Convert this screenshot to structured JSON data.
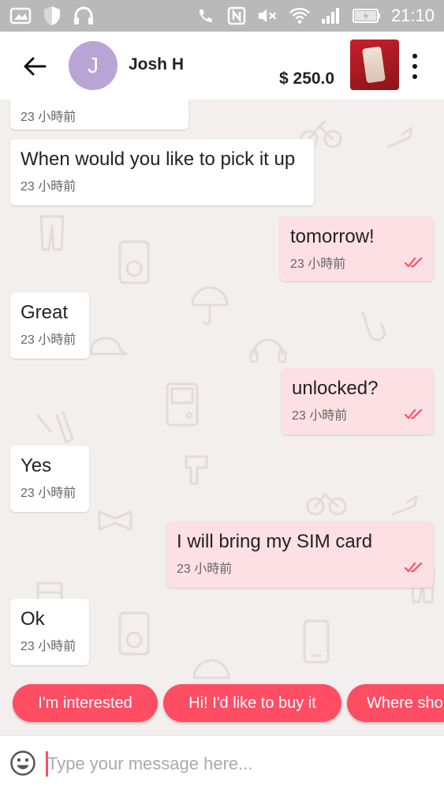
{
  "status_bar": {
    "time": "21:10"
  },
  "header": {
    "avatar_letter": "J",
    "contact_name": "Josh H",
    "price": "$ 250.0",
    "avatar_color": "#b9a4d6"
  },
  "messages": [
    {
      "direction": "in",
      "text": "",
      "time": "23 小時前"
    },
    {
      "direction": "in",
      "text": "When would you like to pick it up",
      "time": "23 小時前"
    },
    {
      "direction": "out",
      "text": "tomorrow!",
      "time": "23 小時前",
      "read": true
    },
    {
      "direction": "in",
      "text": "Great",
      "time": "23 小時前"
    },
    {
      "direction": "out",
      "text": "unlocked?",
      "time": "23 小時前",
      "read": true
    },
    {
      "direction": "in",
      "text": "Yes",
      "time": "23 小時前"
    },
    {
      "direction": "out",
      "text": "I will bring my SIM card",
      "time": "23 小時前",
      "read": true
    },
    {
      "direction": "in",
      "text": "Ok",
      "time": "23 小時前"
    }
  ],
  "quick_replies": [
    "I'm interested",
    "Hi! I'd like to buy it",
    "Where sho"
  ],
  "input": {
    "placeholder": "Type your message here..."
  },
  "colors": {
    "accent": "#ff4d64",
    "outgoing_bubble": "#fde0e3",
    "incoming_bubble": "#ffffff",
    "chat_background": "#f3efef"
  },
  "icons": [
    "back-arrow-icon",
    "more-vert-icon",
    "double-check-icon",
    "emoji-icon",
    "gallery-icon",
    "shield-icon",
    "headphones-icon",
    "phone-call-icon",
    "nfc-icon",
    "mute-icon",
    "wifi-icon",
    "signal-icon",
    "battery-icon"
  ]
}
